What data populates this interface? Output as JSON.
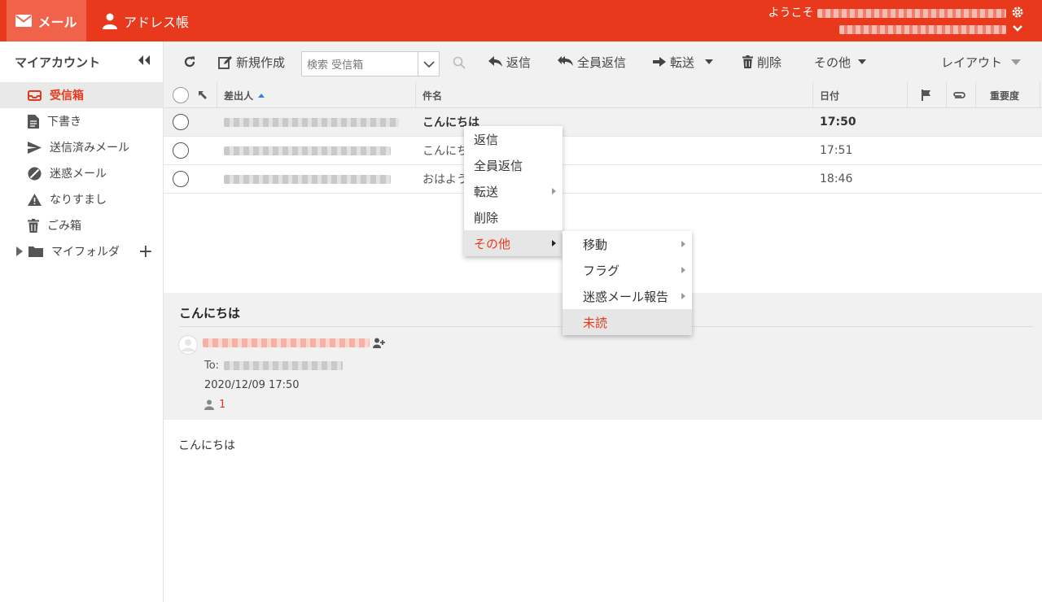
{
  "topbar": {
    "mail_label": "メール",
    "address_label": "アドレス帳",
    "welcome": "ようこそ"
  },
  "sidebar": {
    "title": "マイアカウント",
    "items": [
      {
        "label": "受信箱"
      },
      {
        "label": "下書き"
      },
      {
        "label": "送信済みメール"
      },
      {
        "label": "迷惑メール"
      },
      {
        "label": "なりすまし"
      },
      {
        "label": "ごみ箱"
      }
    ],
    "folder_label": "マイフォルダ"
  },
  "toolbar": {
    "new_label": "新規作成",
    "search_placeholder": "検索 受信箱",
    "reply_label": "返信",
    "reply_all_label": "全員返信",
    "forward_label": "転送",
    "delete_label": "削除",
    "more_label": "その他",
    "layout_label": "レイアウト"
  },
  "list": {
    "columns": {
      "from": "差出人",
      "subject": "件名",
      "date": "日付",
      "importance": "重要度"
    },
    "rows": [
      {
        "subject": "こんにちは",
        "date": "17:50"
      },
      {
        "subject": "こんにち",
        "date": "17:51"
      },
      {
        "subject": "おはよう",
        "date": "18:46"
      }
    ]
  },
  "preview": {
    "subject": "こんにちは",
    "to_label": "To:",
    "date": "2020/12/09 17:50",
    "recipient_count": "1",
    "body": "こんにちは"
  },
  "context_menu": {
    "items": [
      {
        "label": "返信"
      },
      {
        "label": "全員返信"
      },
      {
        "label": "転送"
      },
      {
        "label": "削除"
      },
      {
        "label": "その他"
      }
    ]
  },
  "submenu": {
    "items": [
      {
        "label": "移動"
      },
      {
        "label": "フラグ"
      },
      {
        "label": "迷惑メール報告"
      },
      {
        "label": "未読"
      }
    ]
  },
  "colors": {
    "brand": "#e9391c",
    "toolbar_bg": "#f1f1f1"
  }
}
